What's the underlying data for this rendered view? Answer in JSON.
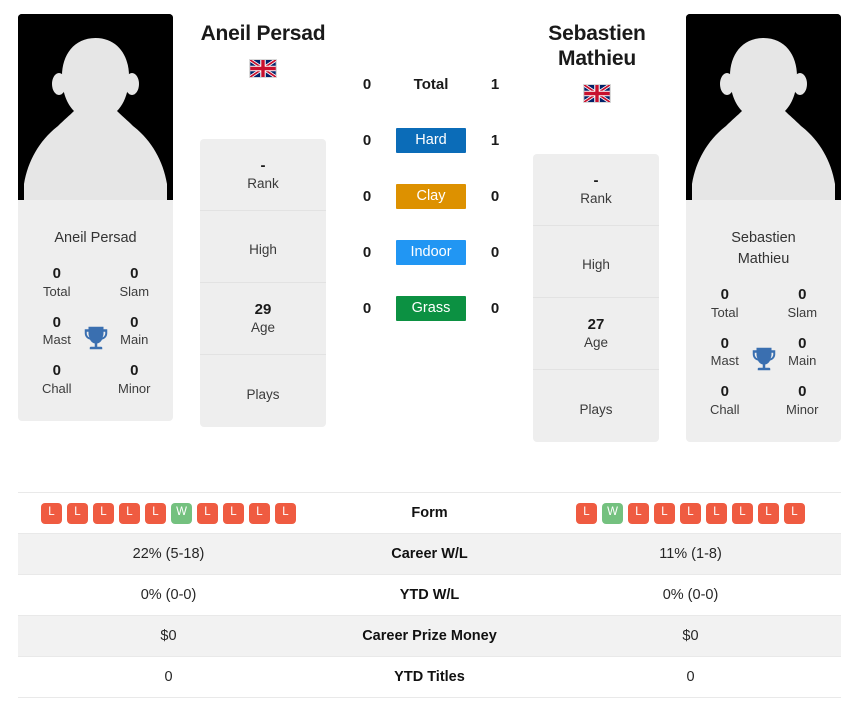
{
  "colors": {
    "hard": "#0b6cb8",
    "clay": "#dd9100",
    "indoor": "#2196f3",
    "grass": "#0c9142",
    "win": "#74c17f",
    "loss": "#ef5b41",
    "trophy": "#3a6fb0",
    "panel_bg": "#eeeeee",
    "stripe_bg": "#f2f2f2"
  },
  "players": {
    "left": {
      "name": "Aneil Persad",
      "name_line1": "Aneil Persad",
      "name_line2": "",
      "card_name": "Aneil Persad",
      "flag": "united-kingdom-flag",
      "titles": [
        {
          "value": "0",
          "label": "Total"
        },
        {
          "value": "0",
          "label": "Slam"
        },
        {
          "value": "0",
          "label": "Mast"
        },
        {
          "value": "0",
          "label": "Main"
        },
        {
          "value": "0",
          "label": "Chall"
        },
        {
          "value": "0",
          "label": "Minor"
        }
      ],
      "info": [
        {
          "value": "-",
          "label": "Rank"
        },
        {
          "value": "",
          "label": "High"
        },
        {
          "value": "29",
          "label": "Age"
        },
        {
          "value": "",
          "label": "Plays"
        }
      ],
      "form": [
        "L",
        "L",
        "L",
        "L",
        "L",
        "W",
        "L",
        "L",
        "L",
        "L"
      ]
    },
    "right": {
      "name": "Sebastien Mathieu",
      "name_line1": "Sebastien",
      "name_line2": "Mathieu",
      "card_name_line1": "Sebastien",
      "card_name_line2": "Mathieu",
      "flag": "united-kingdom-flag",
      "titles": [
        {
          "value": "0",
          "label": "Total"
        },
        {
          "value": "0",
          "label": "Slam"
        },
        {
          "value": "0",
          "label": "Mast"
        },
        {
          "value": "0",
          "label": "Main"
        },
        {
          "value": "0",
          "label": "Chall"
        },
        {
          "value": "0",
          "label": "Minor"
        }
      ],
      "info": [
        {
          "value": "-",
          "label": "Rank"
        },
        {
          "value": "",
          "label": "High"
        },
        {
          "value": "27",
          "label": "Age"
        },
        {
          "value": "",
          "label": "Plays"
        }
      ],
      "form": [
        "L",
        "W",
        "L",
        "L",
        "L",
        "L",
        "L",
        "L",
        "L"
      ]
    }
  },
  "h2h": [
    {
      "left": "0",
      "label": "Total",
      "right": "1",
      "style": "plain",
      "color": ""
    },
    {
      "left": "0",
      "label": "Hard",
      "right": "1",
      "style": "badge",
      "color": "#0b6cb8"
    },
    {
      "left": "0",
      "label": "Clay",
      "right": "0",
      "style": "badge",
      "color": "#dd9100"
    },
    {
      "left": "0",
      "label": "Indoor",
      "right": "0",
      "style": "badge",
      "color": "#2196f3"
    },
    {
      "left": "0",
      "label": "Grass",
      "right": "0",
      "style": "badge",
      "color": "#0c9142"
    }
  ],
  "comparison": {
    "rows": [
      {
        "label": "Form",
        "type": "form",
        "left": "",
        "right": ""
      },
      {
        "label": "Career W/L",
        "type": "text",
        "left": "22% (5-18)",
        "right": "11% (1-8)"
      },
      {
        "label": "YTD W/L",
        "type": "text",
        "left": "0% (0-0)",
        "right": "0% (0-0)"
      },
      {
        "label": "Career Prize Money",
        "type": "text",
        "left": "$0",
        "right": "$0"
      },
      {
        "label": "YTD Titles",
        "type": "text",
        "left": "0",
        "right": "0"
      }
    ]
  }
}
